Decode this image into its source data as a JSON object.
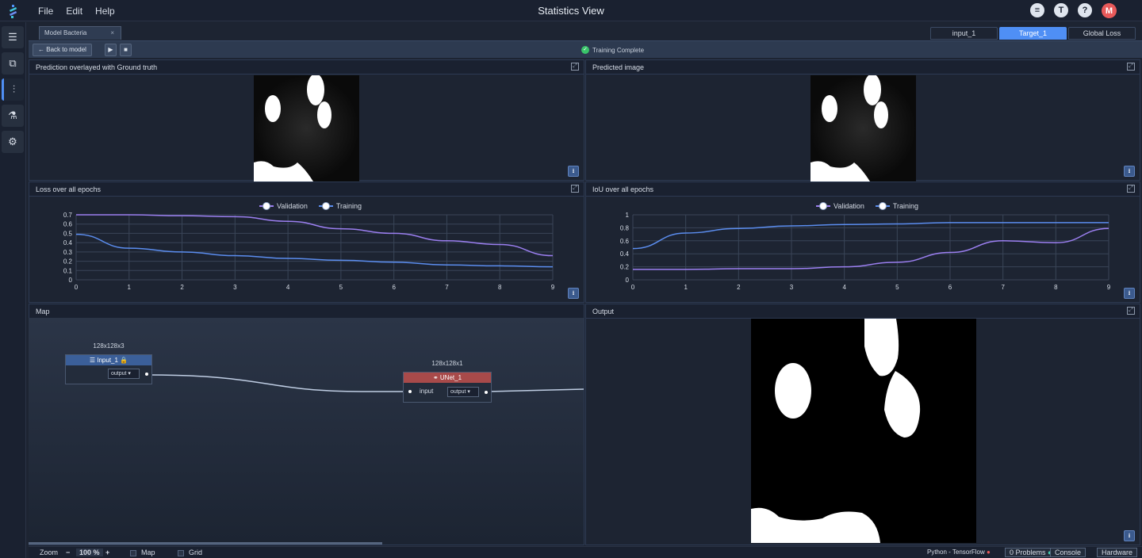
{
  "app": {
    "title": "Statistics View"
  },
  "menu": {
    "file": "File",
    "edit": "Edit",
    "help": "Help"
  },
  "header_icons": {
    "chat": "chat-icon",
    "tensorflow": "tensorflow-icon",
    "help": "?",
    "avatar": "M"
  },
  "sidebar": {
    "items": [
      "workflow-icon",
      "model-icon",
      "statistics-icon",
      "test-icon",
      "settings-icon"
    ],
    "active": "statistics-icon"
  },
  "document_tab": {
    "label": "Model Bacteria",
    "close": "×"
  },
  "view_tabs": [
    {
      "label": "input_1",
      "active": false
    },
    {
      "label": "Target_1",
      "active": true
    },
    {
      "label": "Global Loss",
      "active": false
    }
  ],
  "toolbar": {
    "back_label": "Back to model",
    "status": "Training Complete"
  },
  "panels": {
    "prediction_overlay": "Prediction overlayed with Ground truth",
    "predicted_image": "Predicted image",
    "loss": "Loss over all epochs",
    "iou": "IoU over all epochs",
    "map": "Map",
    "output": "Output"
  },
  "chart_data": [
    {
      "type": "line",
      "title": "Loss over all epochs",
      "x": [
        0,
        1,
        2,
        3,
        4,
        5,
        6,
        7,
        8,
        9
      ],
      "ylim": [
        0,
        0.7
      ],
      "yticks": [
        "0.7",
        "0.6",
        "0.5",
        "0.4",
        "0.3",
        "0.2",
        "0.1",
        "0"
      ],
      "grid": true,
      "legend": "top-center",
      "series": [
        {
          "name": "Validation",
          "color": "#9b7ff0",
          "values": [
            0.7,
            0.7,
            0.69,
            0.68,
            0.63,
            0.55,
            0.5,
            0.42,
            0.38,
            0.26
          ]
        },
        {
          "name": "Training",
          "color": "#5b8def",
          "values": [
            0.49,
            0.34,
            0.3,
            0.26,
            0.23,
            0.21,
            0.19,
            0.16,
            0.15,
            0.14
          ]
        }
      ]
    },
    {
      "type": "line",
      "title": "IoU over all epochs",
      "x": [
        0,
        1,
        2,
        3,
        4,
        5,
        6,
        7,
        8,
        9
      ],
      "ylim": [
        0,
        1
      ],
      "yticks": [
        "1",
        "0.8",
        "0.6",
        "0.4",
        "0.2",
        "0"
      ],
      "grid": true,
      "legend": "top-center",
      "series": [
        {
          "name": "Validation",
          "color": "#9b7ff0",
          "values": [
            0.16,
            0.16,
            0.17,
            0.17,
            0.2,
            0.27,
            0.42,
            0.6,
            0.57,
            0.79
          ]
        },
        {
          "name": "Training",
          "color": "#5b8def",
          "values": [
            0.48,
            0.72,
            0.79,
            0.83,
            0.85,
            0.86,
            0.88,
            0.88,
            0.88,
            0.88
          ]
        }
      ]
    }
  ],
  "map": {
    "input_node": {
      "shape": "128x128x3",
      "name": "Input_1",
      "output": "output"
    },
    "unet_node": {
      "shape": "128x128x1",
      "name": "UNet_1",
      "input": "input",
      "output": "output"
    }
  },
  "bottom": {
    "zoom_label": "Zoom",
    "zoom_minus": "−",
    "zoom_value": "100",
    "zoom_unit": "%",
    "zoom_plus": "+",
    "map": "Map",
    "grid": "Grid",
    "engine": "Python - TensorFlow",
    "problems": "0 Problems",
    "console": "Console",
    "hardware": "Hardware"
  },
  "colors": {
    "accent": "#4f8ff5",
    "unet_header": "#a84a4a",
    "input_header": "#3b5f99",
    "success": "#39c46a"
  }
}
